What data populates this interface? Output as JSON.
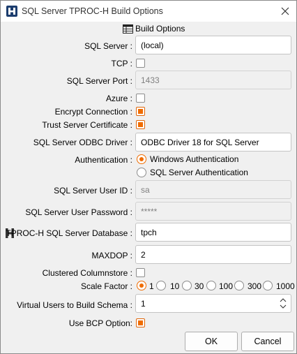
{
  "window": {
    "title": "SQL Server TPROC-H Build Options"
  },
  "header": {
    "label": "Build Options"
  },
  "form": {
    "sql_server": {
      "label": "SQL Server :",
      "value": "(local)"
    },
    "tcp": {
      "label": "TCP :",
      "checked": false
    },
    "port": {
      "label": "SQL Server Port :",
      "value": "1433"
    },
    "azure": {
      "label": "Azure :",
      "checked": false
    },
    "encrypt": {
      "label": "Encrypt Connection :",
      "checked": true
    },
    "trust": {
      "label": "Trust Server Certificate :",
      "checked": true
    },
    "odbc": {
      "label": "SQL Server ODBC Driver :",
      "value": "ODBC Driver 18 for SQL Server"
    },
    "auth": {
      "label": "Authentication :",
      "options": [
        "Windows Authentication",
        "SQL Server Authentication"
      ],
      "selected": "Windows Authentication"
    },
    "user_id": {
      "label": "SQL Server User ID :",
      "value": "sa"
    },
    "password": {
      "label": "SQL Server User Password :",
      "value": "*****"
    },
    "database": {
      "label": "TPROC-H SQL Server Database :",
      "value": "tpch"
    },
    "maxdop": {
      "label": "MAXDOP :",
      "value": "2"
    },
    "columnstore": {
      "label": "Clustered Columnstore :",
      "checked": false
    },
    "scale_factor": {
      "label": "Scale Factor :",
      "options": [
        "1",
        "10",
        "30",
        "100",
        "300",
        "1000"
      ],
      "selected": "1"
    },
    "virtual_users": {
      "label": "Virtual Users to Build Schema :",
      "value": "1"
    },
    "bcp": {
      "label": "Use BCP Option:",
      "checked": true
    }
  },
  "buttons": {
    "ok": "OK",
    "cancel": "Cancel"
  },
  "colors": {
    "accent": "#ef6c00",
    "hammer_icon": "#1c3d6e"
  }
}
